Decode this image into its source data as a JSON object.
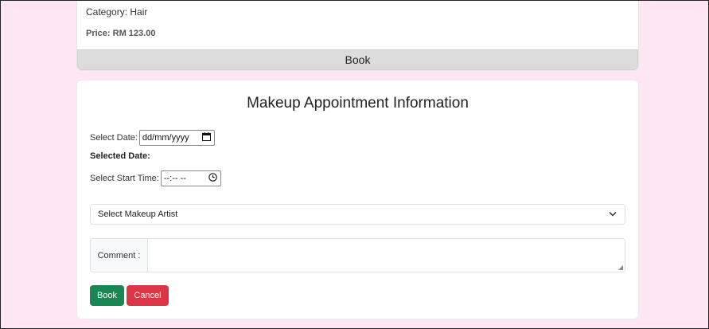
{
  "product": {
    "category": "Category: Hair",
    "price": "Price: RM 123.00",
    "book_label": "Book"
  },
  "form": {
    "title": "Makeup Appointment Information",
    "date_label": "Select Date:",
    "date_value": "dd/mm/yyyy",
    "selected_date_label": "Selected Date:",
    "time_label": "Select Start Time:",
    "time_value": "--:-- --",
    "artist_select": "Select Makeup Artist",
    "comment_label": "Comment :",
    "comment_value": "",
    "book_button": "Book",
    "cancel_button": "Cancel"
  },
  "icons": {
    "calendar": "calendar-icon",
    "clock": "clock-icon",
    "chevron": "chevron-down-icon"
  },
  "colors": {
    "background": "#ffe6f2",
    "book_button": "#198754",
    "cancel_button": "#dc3545"
  }
}
